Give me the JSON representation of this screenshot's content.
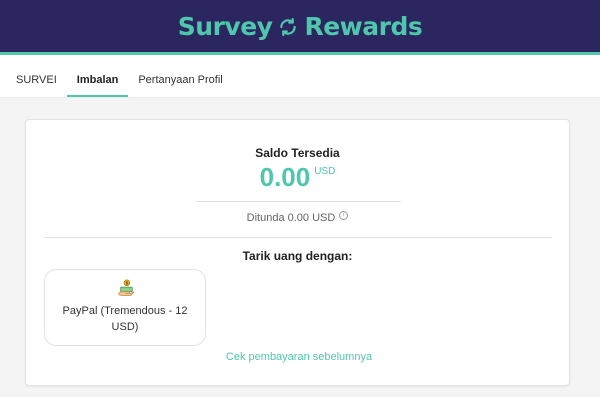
{
  "header": {
    "brand_left": "Survey",
    "brand_right": "Rewards",
    "brand_icon": "refresh-cycle-icon",
    "colors": {
      "background": "#2c2660",
      "accent": "#4fc7ad"
    }
  },
  "tabs": [
    {
      "label": "SURVEI",
      "active": false
    },
    {
      "label": "Imbalan",
      "active": true
    },
    {
      "label": "Pertanyaan Profil",
      "active": false
    }
  ],
  "balance": {
    "title": "Saldo Tersedia",
    "amount": "0.00",
    "currency": "USD",
    "pending": "Ditunda 0.00 USD",
    "info_icon": "info-icon"
  },
  "withdraw": {
    "title": "Tarik uang dengan:",
    "methods": [
      {
        "label": "PayPal (Tremendous - 12 USD)",
        "icon": "money-hand-icon"
      }
    ],
    "history_link": "Cek pembayaran sebelumnya"
  }
}
